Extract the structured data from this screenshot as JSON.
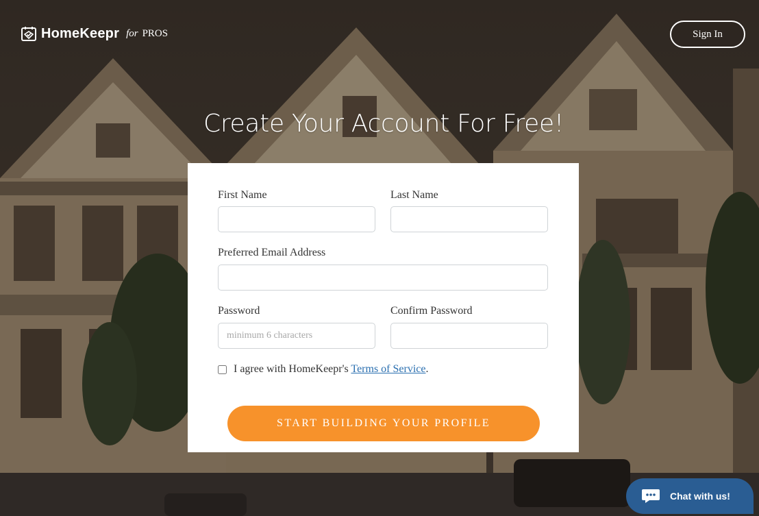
{
  "header": {
    "brand": "HomeKeepr",
    "brand_for": "for",
    "brand_pros": "PROS",
    "signin_label": "Sign In"
  },
  "headline": "Create Your Account For Free!",
  "form": {
    "first_name_label": "First Name",
    "first_name_value": "",
    "last_name_label": "Last Name",
    "last_name_value": "",
    "email_label": "Preferred Email Address",
    "email_value": "",
    "password_label": "Password",
    "password_placeholder": "minimum 6 characters",
    "confirm_label": "Confirm Password",
    "agree_text": "I agree with HomeKeepr's",
    "terms_link": "Terms of Service",
    "agree_end": ".",
    "agree_checked": false,
    "submit_label": "START BUILDING YOUR PROFILE"
  },
  "chat": {
    "label": "Chat with us!"
  },
  "colors": {
    "accent": "#f7922b",
    "chat": "#2a5d93",
    "link": "#2a6fb0"
  }
}
